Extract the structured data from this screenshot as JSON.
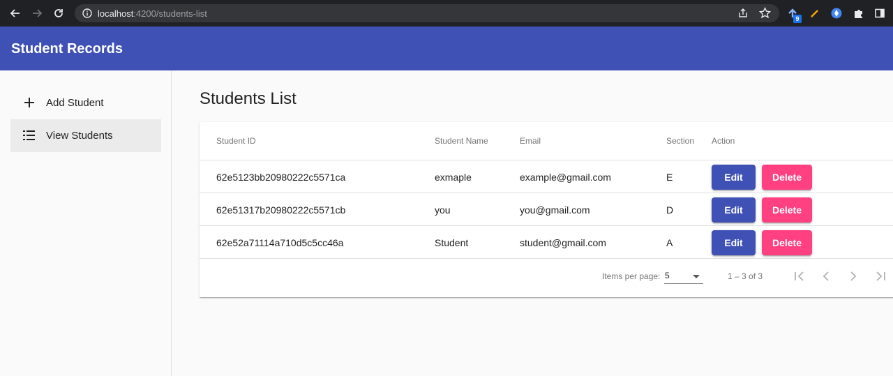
{
  "browser": {
    "url_host": "localhost",
    "url_path": ":4200/students-list",
    "ext_badge": "9"
  },
  "app": {
    "title": "Student Records",
    "colors": {
      "primary": "#3f51b5",
      "accent": "#ff4081"
    }
  },
  "sidebar": {
    "items": [
      {
        "label": "Add Student",
        "icon": "plus-icon"
      },
      {
        "label": "View Students",
        "icon": "list-icon",
        "active": true
      }
    ]
  },
  "main": {
    "title": "Students List",
    "table": {
      "headers": {
        "id": "Student ID",
        "name": "Student Name",
        "email": "Email",
        "section": "Section",
        "action": "Action"
      },
      "rows": [
        {
          "id": "62e5123bb20980222c5571ca",
          "name": "exmaple",
          "email": "example@gmail.com",
          "section": "E"
        },
        {
          "id": "62e51317b20980222c5571cb",
          "name": "you",
          "email": "you@gmail.com",
          "section": "D"
        },
        {
          "id": "62e52a71114a710d5c5cc46a",
          "name": "Student",
          "email": "student@gmail.com",
          "section": "A"
        }
      ],
      "edit_label": "Edit",
      "delete_label": "Delete"
    },
    "paginator": {
      "items_per_page_label": "Items per page:",
      "page_size": "5",
      "range": "1 – 3 of 3"
    }
  }
}
